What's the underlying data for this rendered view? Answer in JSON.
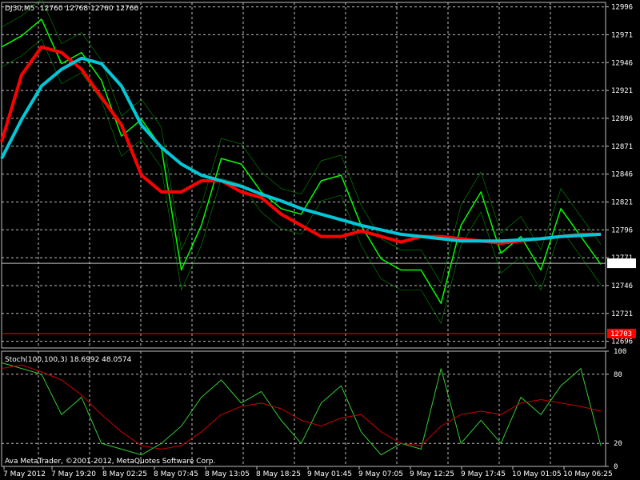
{
  "header": {
    "symbol": "DJ30,M5",
    "ohlc": "12760 12768 12760 12766"
  },
  "stoch_label": "Stoch(100,100,3) 18.6992 48.0574",
  "copyright": "Ava MetaTrader, ©2001-2012, MetaQuotes Software Corp.",
  "colors": {
    "background": "#000000",
    "grid": "#c0c0c0",
    "price": "#00ff00",
    "ma_fast": "#ff0000",
    "ma_slow": "#00c8d8",
    "envelope": "#00cc00",
    "stoch_main": "#33cc33",
    "stoch_signal": "#cc0000",
    "bid_line": "#c0c0c0",
    "alert_line": "#ff0000"
  },
  "chart_data": [
    {
      "type": "line",
      "title": "DJ30,M5",
      "y_ticks": [
        "12996",
        "12971",
        "12946",
        "12921",
        "12896",
        "12871",
        "12846",
        "12821",
        "12796",
        "12771",
        "12746",
        "12721",
        "12696"
      ],
      "ylim": [
        12690,
        13000
      ],
      "current_price": "12766",
      "red_level": "12703",
      "x_labels": [
        "7 May 2012",
        "7 May 19:20",
        "8 May 02:25",
        "8 May 07:45",
        "8 May 13:05",
        "8 May 18:25",
        "9 May 01:45",
        "9 May 07:05",
        "9 May 12:25",
        "9 May 17:45",
        "10 May 01:05",
        "10 May 06:25"
      ],
      "x": [
        0,
        4,
        8,
        12,
        16,
        20,
        24,
        28,
        32,
        36,
        40,
        44,
        48,
        52,
        56,
        60,
        64,
        68,
        72,
        76,
        80,
        84,
        88,
        92,
        96,
        100,
        104,
        108,
        112,
        116,
        120
      ],
      "series": [
        {
          "values": [
            12960,
            12970,
            12985,
            12945,
            12955,
            12930,
            12880,
            12895,
            12870,
            12760,
            12800,
            12860,
            12855,
            12830,
            12815,
            12810,
            12840,
            12845,
            12800,
            12770,
            12760,
            12760,
            12730,
            12800,
            12830,
            12775,
            12790,
            12760,
            12815,
            12790,
            12765
          ]
        },
        {
          "values": [
            12875,
            12935,
            12960,
            12955,
            12940,
            12915,
            12890,
            12845,
            12830,
            12830,
            12840,
            12840,
            12830,
            12825,
            12810,
            12800,
            12790,
            12790,
            12795,
            12790,
            12785,
            12790,
            12790,
            12788,
            12786,
            12784,
            12786,
            12788,
            12790,
            12792,
            12792
          ]
        },
        {
          "values": [
            12860,
            12895,
            12925,
            12940,
            12950,
            12945,
            12925,
            12890,
            12870,
            12855,
            12845,
            12840,
            12835,
            12828,
            12822,
            12815,
            12810,
            12805,
            12800,
            12796,
            12792,
            12790,
            12788,
            12786,
            12786,
            12786,
            12787,
            12788,
            12790,
            12791,
            12792
          ]
        }
      ]
    },
    {
      "type": "line",
      "title": "Stoch(100,100,3)",
      "y_ticks": [
        "100",
        "80",
        "20",
        "0"
      ],
      "ylim": [
        0,
        100
      ],
      "x": [
        0,
        4,
        8,
        12,
        16,
        20,
        24,
        28,
        32,
        36,
        40,
        44,
        48,
        52,
        56,
        60,
        64,
        68,
        72,
        76,
        80,
        84,
        88,
        92,
        96,
        100,
        104,
        108,
        112,
        116,
        120
      ],
      "series": [
        {
          "values": [
            90,
            85,
            80,
            45,
            60,
            20,
            15,
            10,
            20,
            35,
            60,
            75,
            55,
            65,
            40,
            20,
            55,
            70,
            30,
            10,
            20,
            15,
            85,
            20,
            40,
            20,
            60,
            45,
            70,
            85,
            18
          ]
        },
        {
          "values": [
            85,
            88,
            82,
            75,
            62,
            45,
            30,
            18,
            15,
            18,
            30,
            45,
            52,
            55,
            50,
            40,
            35,
            42,
            45,
            30,
            20,
            18,
            35,
            45,
            48,
            45,
            55,
            58,
            55,
            52,
            48
          ]
        }
      ]
    }
  ]
}
